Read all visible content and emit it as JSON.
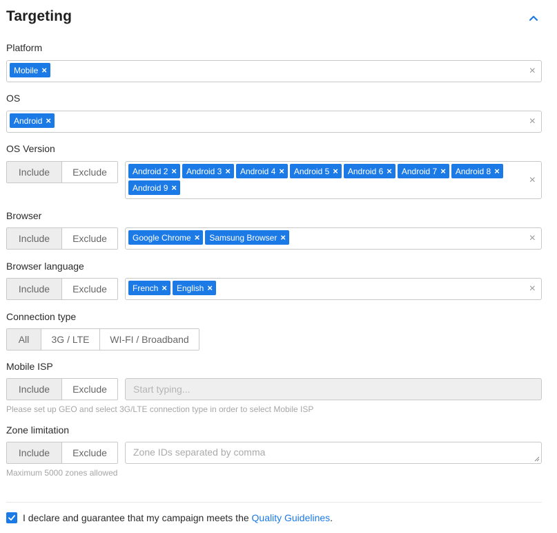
{
  "section": {
    "title": "Targeting",
    "collapse_icon": "chevron-up-icon"
  },
  "platform": {
    "label": "Platform",
    "tags": [
      "Mobile"
    ],
    "clear": "×"
  },
  "os": {
    "label": "OS",
    "tags": [
      "Android"
    ],
    "clear": "×"
  },
  "os_version": {
    "label": "OS Version",
    "include_label": "Include",
    "exclude_label": "Exclude",
    "selected": "Include",
    "tags": [
      "Android 2",
      "Android 3",
      "Android 4",
      "Android 5",
      "Android 6",
      "Android 7",
      "Android 8",
      "Android 9"
    ],
    "clear": "×"
  },
  "browser": {
    "label": "Browser",
    "include_label": "Include",
    "exclude_label": "Exclude",
    "selected": "Include",
    "tags": [
      "Google Chrome",
      "Samsung Browser"
    ],
    "clear": "×"
  },
  "browser_language": {
    "label": "Browser language",
    "include_label": "Include",
    "exclude_label": "Exclude",
    "selected": "Include",
    "tags": [
      "French",
      "English"
    ],
    "clear": "×"
  },
  "connection_type": {
    "label": "Connection type",
    "options": [
      "All",
      "3G / LTE",
      "WI-FI / Broadband"
    ],
    "selected": "All"
  },
  "mobile_isp": {
    "label": "Mobile ISP",
    "include_label": "Include",
    "exclude_label": "Exclude",
    "selected": "Include",
    "placeholder": "Start typing...",
    "hint": "Please set up GEO and select 3G/LTE connection type in order to select Mobile ISP"
  },
  "zone_limitation": {
    "label": "Zone limitation",
    "include_label": "Include",
    "exclude_label": "Exclude",
    "selected": "Include",
    "placeholder": "Zone IDs separated by comma",
    "hint": "Maximum 5000 zones allowed"
  },
  "declaration": {
    "checked": true,
    "text": "I declare and guarantee that my campaign meets the",
    "link": "Quality Guidelines",
    "suffix": "."
  },
  "colors": {
    "accent": "#1b7ae6",
    "border": "#c8c8c8",
    "active_segment": "#ededed"
  }
}
